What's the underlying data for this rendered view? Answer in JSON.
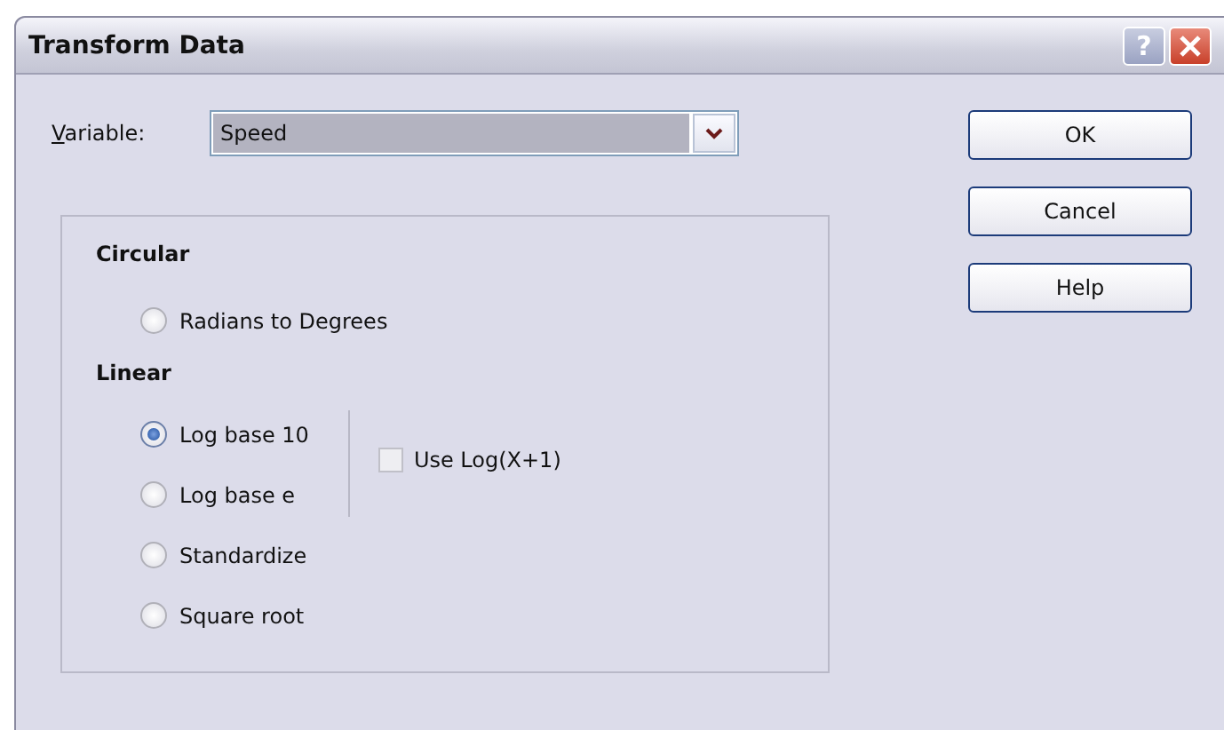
{
  "window": {
    "title": "Transform Data",
    "help_button": "?"
  },
  "variable": {
    "label": "Variable:",
    "value": "Speed"
  },
  "buttons": [
    "OK",
    "Cancel",
    "Help"
  ],
  "groups": [
    {
      "heading": "Circular",
      "options": [
        {
          "label": "Radians to Degrees",
          "selected": false
        }
      ]
    },
    {
      "heading": "Linear",
      "options": [
        {
          "label": "Log base 10",
          "selected": true
        },
        {
          "label": "Log base e",
          "selected": false
        },
        {
          "label": "Standardize",
          "selected": false
        },
        {
          "label": "Square root",
          "selected": false
        }
      ]
    }
  ],
  "log_plus_one": {
    "label": "Use Log(X+1)",
    "checked": false
  }
}
